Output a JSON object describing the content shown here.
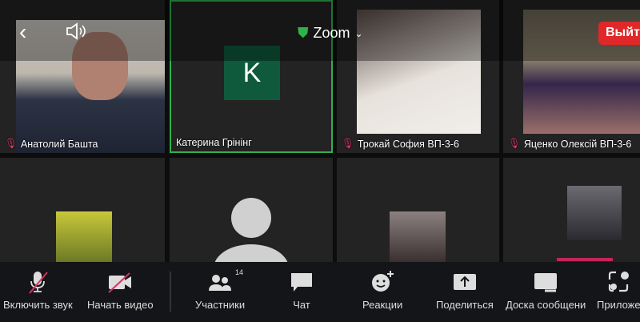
{
  "header": {
    "app_label": "Zoom",
    "leave_label": "Выйти"
  },
  "participants": [
    {
      "name": "Анатолий Башта",
      "muted": true
    },
    {
      "name": "Катерина Грінінг",
      "initial": "K",
      "active": true
    },
    {
      "name": "Трокай София ВП-3-6",
      "muted": true
    },
    {
      "name": "Яценко Олексій ВП-3-6",
      "muted": true
    }
  ],
  "toolbar": {
    "unmute": "Включить звук",
    "start_video": "Начать видео",
    "participants": "Участники",
    "participants_count": "14",
    "chat": "Чат",
    "reactions": "Реакции",
    "share": "Поделиться",
    "whiteboard": "Доска сообщени",
    "apps": "Приложе"
  },
  "colors": {
    "accent_green": "#2fb14b",
    "leave_red": "#e02828",
    "mute_slash": "#d6335e"
  }
}
